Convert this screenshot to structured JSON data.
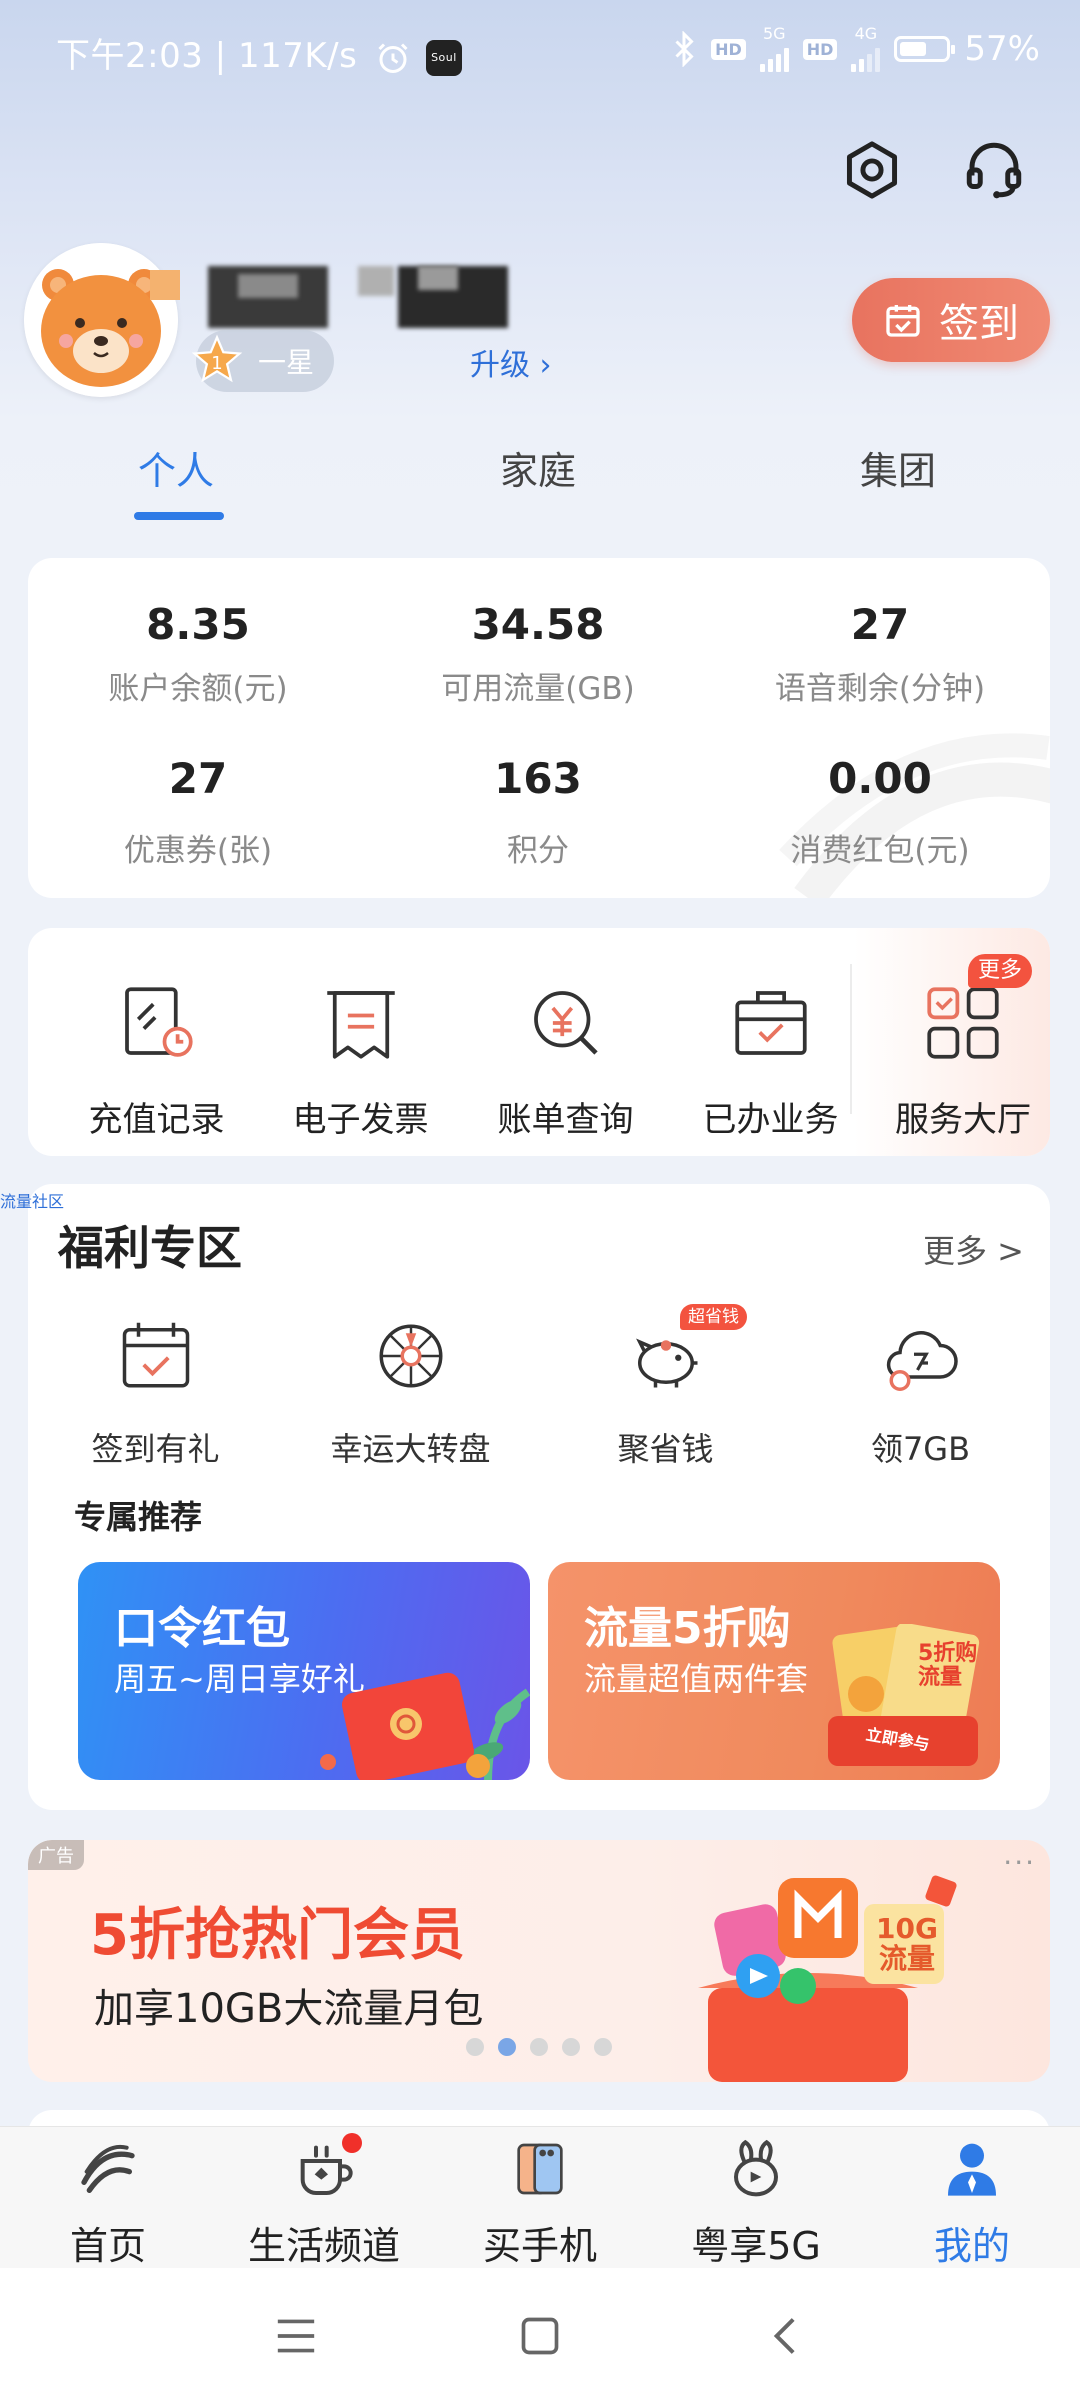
{
  "status_bar": {
    "time": "下午2:03",
    "speed": "117K/s",
    "battery": "57%",
    "battery_level": 0.57,
    "app_badge": "Soul",
    "network_1": "5G",
    "network_2": "4G",
    "hd_label": "HD"
  },
  "profile": {
    "level_num": "1",
    "level": "一星",
    "upgrade": "升级",
    "checkin": "签到"
  },
  "tabs": [
    {
      "label": "个人",
      "active": true
    },
    {
      "label": "家庭",
      "active": false
    },
    {
      "label": "集团",
      "active": false
    }
  ],
  "stats": [
    {
      "value": "8.35",
      "label": "账户余额(元)"
    },
    {
      "value": "34.58",
      "label": "可用流量(GB)"
    },
    {
      "value": "27",
      "label": "语音剩余(分钟)"
    },
    {
      "value": "27",
      "label": "优惠券(张)"
    },
    {
      "value": "163",
      "label": "积分"
    },
    {
      "value": "0.00",
      "label": "消费红包(元)"
    }
  ],
  "quick_actions": [
    {
      "label": "充值记录",
      "icon": "recharge-record-icon"
    },
    {
      "label": "电子发票",
      "icon": "invoice-icon"
    },
    {
      "label": "账单查询",
      "icon": "bill-query-icon"
    },
    {
      "label": "已办业务",
      "icon": "business-done-icon"
    },
    {
      "label": "服务大厅",
      "icon": "service-hall-icon",
      "badge": "更多"
    }
  ],
  "community_link": "流量社区",
  "welfare": {
    "title": "福利专区",
    "more": "更多 >",
    "items": [
      {
        "label": "签到有礼",
        "icon": "calendar-check-icon"
      },
      {
        "label": "幸运大转盘",
        "icon": "wheel-icon"
      },
      {
        "label": "聚省钱",
        "icon": "piggy-bank-icon",
        "badge": "超省钱"
      },
      {
        "label": "领7GB",
        "icon": "cloud-data-icon"
      }
    ],
    "exclusive_title": "专属推荐",
    "promos": [
      {
        "title": "口令红包",
        "subtitle": "周五~周日享好礼"
      },
      {
        "title": "流量5折购",
        "subtitle": "流量超值两件套",
        "art_text": "5折购流量",
        "cta": "立即参与"
      }
    ]
  },
  "ad": {
    "tag": "广告",
    "title": "5折抢热门会员",
    "subtitle": "加享10GB大流量月包",
    "art_text": "10G流量",
    "dots": 5,
    "active_dot": 1,
    "menu": "···"
  },
  "bottom_nav": [
    {
      "label": "首页",
      "icon": "china-mobile-logo-icon",
      "active": false
    },
    {
      "label": "生活频道",
      "icon": "coffee-cup-icon",
      "active": false,
      "dot": true
    },
    {
      "label": "买手机",
      "icon": "phone-icon",
      "active": false
    },
    {
      "label": "粤享5G",
      "icon": "rabbit-icon",
      "active": false
    },
    {
      "label": "我的",
      "icon": "user-icon",
      "active": true
    }
  ],
  "colors": {
    "accent": "#2f7be6",
    "checkin": "#e8735f",
    "ad_title": "#ef4b33"
  }
}
